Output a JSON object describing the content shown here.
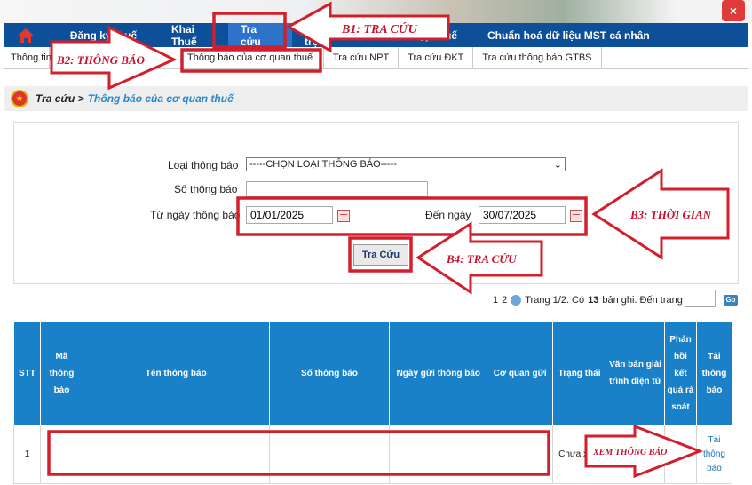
{
  "header": {
    "close_symbol": "×"
  },
  "main_nav": {
    "items": [
      "Đăng ký thuế",
      "Khai Thuế",
      "Tra cứu",
      "Hỗ trợ",
      "Nộp thuế",
      "Chuẩn hoá dữ liệu MST cá nhân"
    ]
  },
  "sub_nav": {
    "items": [
      "Thông tin",
      "cá nhân",
      "Thông báo của cơ quan thuế",
      "Tra cứu NPT",
      "Tra cứu ĐKT",
      "Tra cứu thông báo GTBS"
    ]
  },
  "breadcrumb": {
    "root": "Tra cứu >",
    "current": "Thông báo của cơ quan thuế"
  },
  "form": {
    "type_label": "Loại thông báo",
    "type_value": "-----CHỌN LOẠI THÔNG BÁO-----",
    "number_label": "Số thông báo",
    "number_value": "",
    "from_label": "Từ ngày thông báo",
    "from_value": "01/01/2025",
    "to_label": "Đến ngày",
    "to_value": "30/07/2025",
    "search_button": "Tra Cứu"
  },
  "pager": {
    "pages": [
      "1",
      "2"
    ],
    "summary_prefix": "Trang 1/2. Có",
    "count": "13",
    "summary_suffix": "bản ghi. Đến trang",
    "go": "Go"
  },
  "table": {
    "headers": [
      "STT",
      "Mã thông báo",
      "Tên thông báo",
      "Số thông báo",
      "Ngày gửi thông báo",
      "Cơ quan gửi",
      "Trạng thái",
      "Văn bản giải trình điện tử",
      "Phản hồi kết quả rà soát",
      "Tải thông báo"
    ],
    "rows": [
      {
        "stt": "1",
        "ma": "",
        "ten": "",
        "so": "",
        "ngay": "",
        "co_quan": "",
        "trang_thai": "Chưa xem",
        "van_ban": "",
        "phan_hoi": "",
        "tai": "Tải thông báo"
      }
    ]
  },
  "annotations": {
    "b1": "B1: TRA CỨU",
    "b2": "B2: THÔNG BÁO",
    "b3": "B3: THỜI GIAN",
    "b4": "B4: TRA CỨU",
    "xem": "XEM THÔNG BÁO"
  },
  "colors": {
    "nav_blue": "#0e4f99",
    "header_blue": "#1a80c8",
    "annotation_red": "#c8102e"
  }
}
